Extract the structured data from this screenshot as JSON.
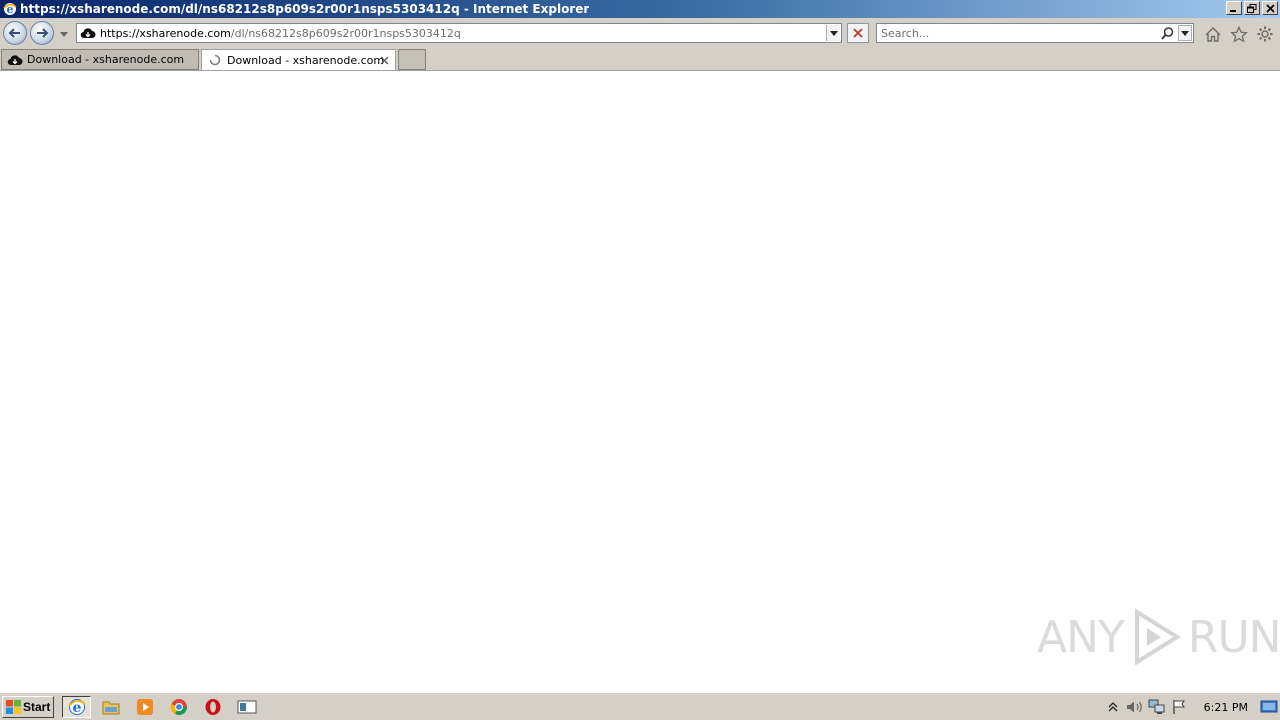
{
  "window": {
    "title": "https://xsharenode.com/dl/ns68212s8p609s2r00r1nsps5303412q - Internet Explorer",
    "icon": "ie-icon"
  },
  "navbar": {
    "address_host": "https://xsharenode.com",
    "address_path": "/dl/ns68212s8p609s2r00r1nsps5303412q",
    "search_placeholder": "Search...",
    "site_icon": "cloud-download-icon"
  },
  "tabs": [
    {
      "label": "Download - xsharenode.com",
      "icon": "cloud-download-icon",
      "active": false
    },
    {
      "label": "Download - xsharenode.com",
      "icon": "loading-spinner-icon",
      "active": true
    }
  ],
  "watermark": {
    "left_text": "ANY",
    "right_text": "RUN"
  },
  "taskbar": {
    "start_label": "Start",
    "clock": "6:21 PM",
    "quicklaunch": [
      "ie-icon",
      "explorer-folder-icon",
      "media-player-icon",
      "chrome-icon",
      "opera-icon",
      "window-app-icon"
    ],
    "tray": [
      "show-hidden-icons-icon",
      "volume-icon",
      "network-icon",
      "action-center-flag-icon"
    ]
  },
  "colors": {
    "titlebar_start": "#0a246a",
    "titlebar_end": "#a6caf0",
    "chrome": "#d4d0c8",
    "stop_red": "#c0392b"
  }
}
